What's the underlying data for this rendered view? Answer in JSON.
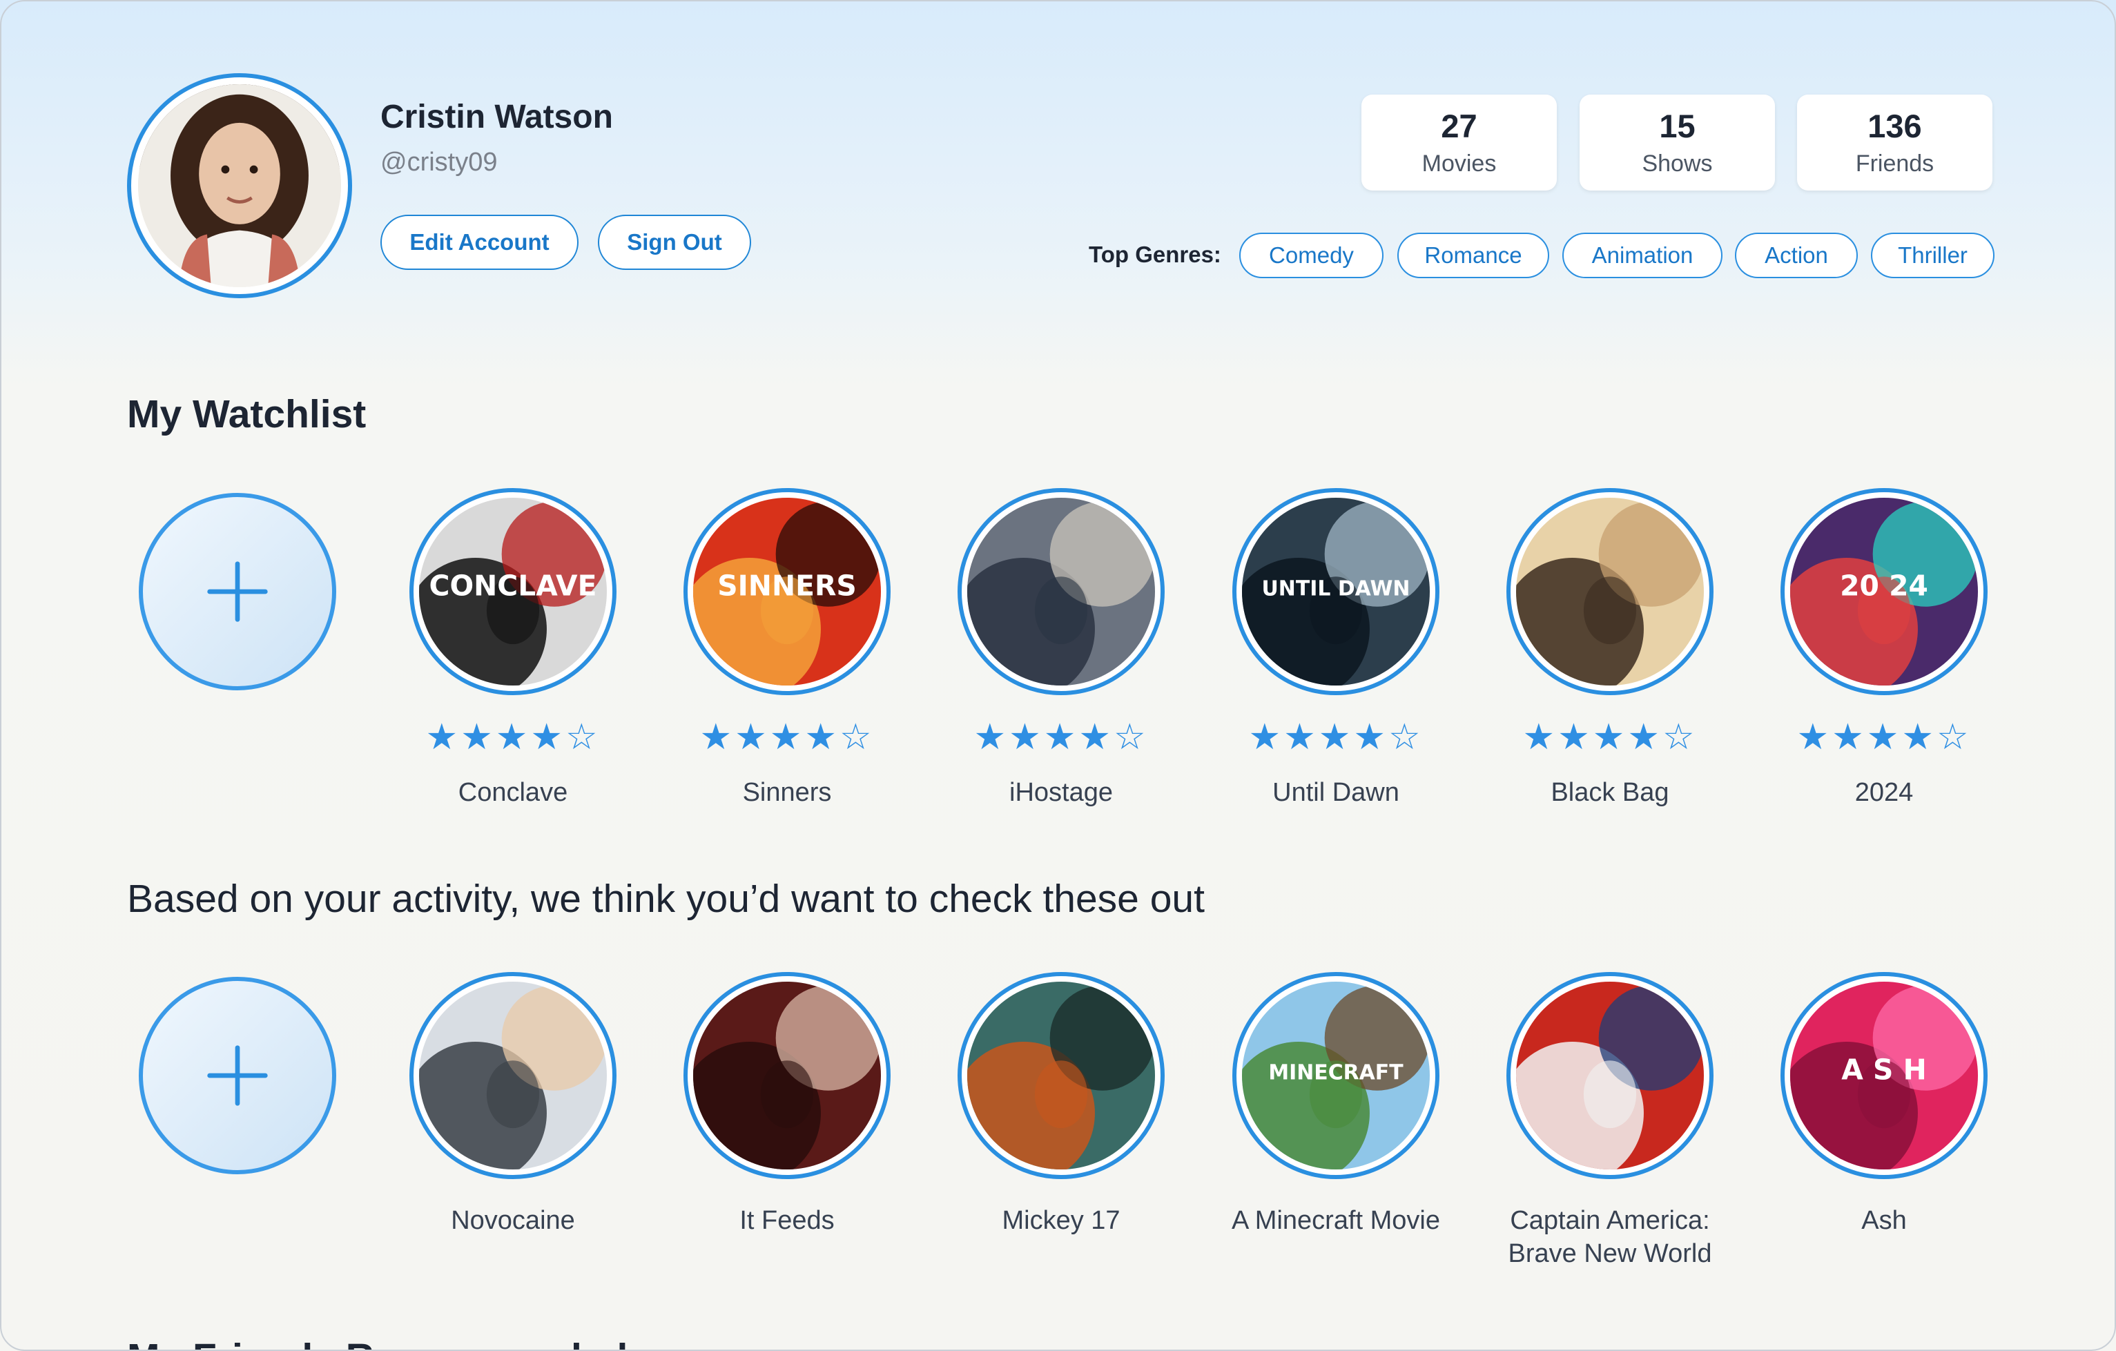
{
  "profile": {
    "name": "Cristin Watson",
    "handle": "@cristy09",
    "edit_label": "Edit Account",
    "signout_label": "Sign Out"
  },
  "stats": [
    {
      "value": "27",
      "label": "Movies"
    },
    {
      "value": "15",
      "label": "Shows"
    },
    {
      "value": "136",
      "label": "Friends"
    }
  ],
  "genres": {
    "label": "Top Genres:",
    "items": [
      "Comedy",
      "Romance",
      "Animation",
      "Action",
      "Thriller"
    ]
  },
  "watchlist": {
    "title": "My Watchlist",
    "items": [
      {
        "title": "Conclave",
        "rating": 4,
        "poster_text": "CONCLAVE",
        "colors": [
          "#d9d9d9",
          "#111111",
          "#b51a1a"
        ]
      },
      {
        "title": "Sinners",
        "rating": 4,
        "poster_text": "SINNERS",
        "colors": [
          "#d8321a",
          "#f4a13a",
          "#2a0c08"
        ]
      },
      {
        "title": "iHostage",
        "rating": 4,
        "poster_text": "",
        "colors": [
          "#6b7380",
          "#2a3342",
          "#c9c4bb"
        ]
      },
      {
        "title": "Until Dawn",
        "rating": 4,
        "poster_text": "UNTIL DAWN",
        "colors": [
          "#2c3e4c",
          "#0c1620",
          "#9fb6c4"
        ]
      },
      {
        "title": "Black Bag",
        "rating": 4,
        "poster_text": "",
        "colors": [
          "#e8d2a8",
          "#3b2b1f",
          "#c8a070"
        ]
      },
      {
        "title": "2024",
        "rating": 4,
        "poster_text": "20 24",
        "colors": [
          "#4a2a6a",
          "#e04040",
          "#2ad0c0"
        ]
      }
    ]
  },
  "recommendations": {
    "title": "Based on your activity, we think you’d want to check these out",
    "items": [
      {
        "title": "Novocaine",
        "poster_text": "",
        "colors": [
          "#d8dde3",
          "#3a3f46",
          "#e9c9a8"
        ]
      },
      {
        "title": "It Feeds",
        "poster_text": "",
        "colors": [
          "#5a1a18",
          "#2a0d0c",
          "#d9b7a5"
        ]
      },
      {
        "title": "Mickey 17",
        "poster_text": "",
        "colors": [
          "#3a6b66",
          "#c8561c",
          "#1a2a28"
        ]
      },
      {
        "title": "A Minecraft Movie",
        "poster_text": "MINECRAFT",
        "colors": [
          "#8fc6e8",
          "#4a8a3a",
          "#6b4a2a"
        ]
      },
      {
        "title": "Captain America: Brave New World",
        "poster_text": "",
        "colors": [
          "#c8281e",
          "#f2f2f2",
          "#1d3c78"
        ]
      },
      {
        "title": "Ash",
        "poster_text": "A S H",
        "colors": [
          "#e0245e",
          "#8a0f3a",
          "#ff6aa8"
        ]
      }
    ]
  },
  "friends_section": {
    "title": "My Friends Recommended"
  },
  "icons": {
    "add": "plus-icon",
    "star_filled": "★",
    "star_empty": "☆"
  },
  "accent_color": "#2a8fe0"
}
